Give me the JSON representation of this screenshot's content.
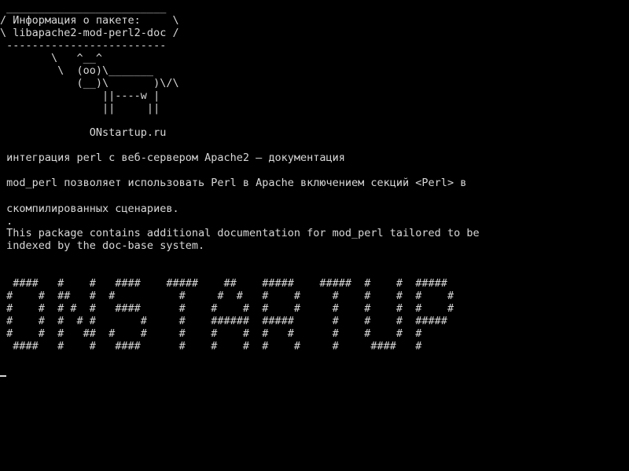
{
  "terminal": {
    "cowsay": {
      "border_top": " _________________________",
      "bubble_line1": "/ Информация о пакете:     \\",
      "bubble_line2": "\\ libapache2-mod-perl2-doc /",
      "border_bottom": " -------------------------",
      "cow_line1": "        \\   ^__^",
      "cow_line2": "         \\  (oo)\\_______",
      "cow_line3": "            (__)\\       )\\/\\",
      "cow_line4": "                ||----w |",
      "cow_line5": "                ||     ||",
      "site": "              ONstartup.ru"
    },
    "package_summary": " интеграция perl с веб-сервером Apache2 — документация",
    "description_ru_line1": " mod_perl позволяет использовать Perl в Apache включением секций <Perl> в",
    "description_ru_line2": " скомпилированных сценариев.",
    "separator_dot": " .",
    "description_en_line1": " This package contains additional documentation for mod_perl tailored to be",
    "description_en_line2": " indexed by the doc-base system.",
    "banner": {
      "row1": "  ####   #    #   ####    #####    ##    #####    #####  #    #  #####",
      "row2": " #    #  ##   #  #          #     #  #   #    #     #    #    #  #    #",
      "row3": " #    #  # #  #   ####      #    #    #  #    #     #    #    #  #    #",
      "row4": " #    #  #  # #       #     #    ######  #####      #    #    #  #####",
      "row5": " #    #  #   ##  #    #     #    #    #  #   #      #    #    #  #",
      "row6": "  ####   #    #   ####      #    #    #  #    #     #     ####   #"
    }
  }
}
